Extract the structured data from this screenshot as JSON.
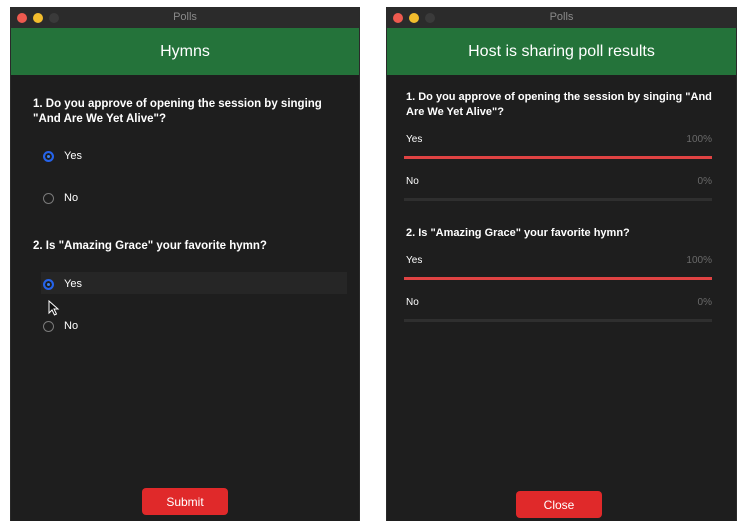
{
  "left": {
    "window_title": "Polls",
    "header": "Hymns",
    "questions": [
      {
        "text": "1. Do you approve of opening the session by singing \"And Are We Yet Alive\"?",
        "options": [
          {
            "label": "Yes",
            "selected": true
          },
          {
            "label": "No",
            "selected": false
          }
        ]
      },
      {
        "text": "2. Is \"Amazing Grace\" your favorite hymn?",
        "options": [
          {
            "label": "Yes",
            "selected": true
          },
          {
            "label": "No",
            "selected": false
          }
        ]
      }
    ],
    "submit_label": "Submit"
  },
  "right": {
    "window_title": "Polls",
    "header": "Host is sharing poll results",
    "questions": [
      {
        "text": "1. Do you approve of opening the session by singing \"And Are We Yet Alive\"?",
        "results": [
          {
            "label": "Yes",
            "percent_text": "100%",
            "percent": 100
          },
          {
            "label": "No",
            "percent_text": "0%",
            "percent": 0
          }
        ]
      },
      {
        "text": "2. Is \"Amazing Grace\" your favorite hymn?",
        "results": [
          {
            "label": "Yes",
            "percent_text": "100%",
            "percent": 100
          },
          {
            "label": "No",
            "percent_text": "0%",
            "percent": 0
          }
        ]
      }
    ],
    "close_label": "Close"
  },
  "colors": {
    "header_green": "#24733a",
    "button_red": "#e0292a",
    "result_bar": "#e04343",
    "radio_selected": "#3b82f6"
  }
}
